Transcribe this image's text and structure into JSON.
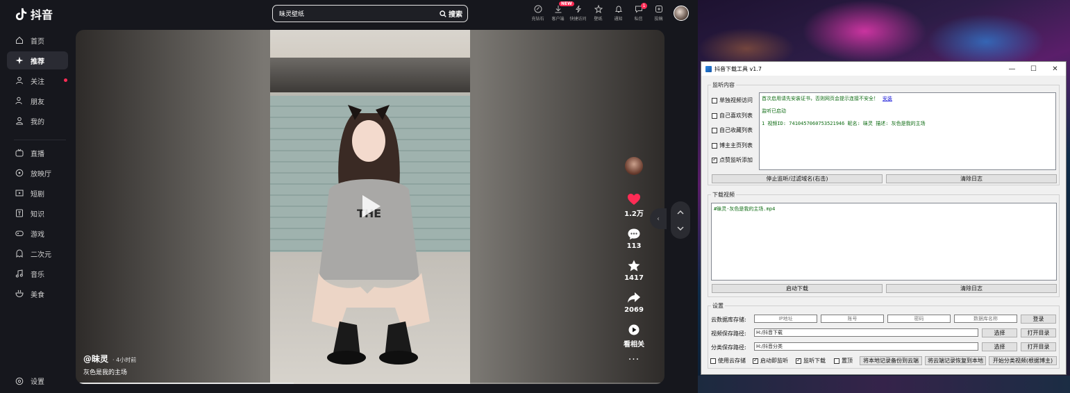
{
  "app": {
    "brand": "抖音"
  },
  "sidebar": {
    "items": [
      {
        "label": "首页"
      },
      {
        "label": "推荐"
      },
      {
        "label": "关注"
      },
      {
        "label": "朋友"
      },
      {
        "label": "我的"
      },
      {
        "label": "直播"
      },
      {
        "label": "放映厅"
      },
      {
        "label": "短剧"
      },
      {
        "label": "知识"
      },
      {
        "label": "游戏"
      },
      {
        "label": "二次元"
      },
      {
        "label": "音乐"
      },
      {
        "label": "美食"
      }
    ],
    "settings_label": "设置"
  },
  "search": {
    "value": "昧灵壁纸",
    "button_label": "搜索"
  },
  "top_actions": [
    {
      "label": "充钻石",
      "icon": "diamond-icon"
    },
    {
      "label": "客户端",
      "icon": "download-icon",
      "badge": "NEW"
    },
    {
      "label": "快捷访问",
      "icon": "bolt-icon"
    },
    {
      "label": "壁纸",
      "icon": "wallpaper-icon"
    },
    {
      "label": "通知",
      "icon": "bell-icon"
    },
    {
      "label": "私信",
      "icon": "message-icon",
      "badge": "1"
    },
    {
      "label": "投稿",
      "icon": "upload-icon"
    }
  ],
  "video": {
    "author": "@昧灵",
    "time": "· 4小时前",
    "description": "灰色是我的主场",
    "progress": 0.37,
    "likes": "1.2万",
    "comments": "113",
    "favorites": "1417",
    "shares": "2069",
    "related_label": "看相关",
    "more": "···"
  },
  "tool": {
    "title": "抖音下载工具 v1.7",
    "listen_group": "监听内容",
    "options": [
      {
        "label": "单独视频访问",
        "checked": false
      },
      {
        "label": "自己喜欢列表",
        "checked": false
      },
      {
        "label": "自己收藏列表",
        "checked": false
      },
      {
        "label": "博主主页列表",
        "checked": false
      },
      {
        "label": "点赞监听添加",
        "checked": true
      }
    ],
    "listen_log": {
      "line1": "首次启用请先安装证书，否则网页会提示连接不安全！",
      "line1_link": "安装",
      "line2": "监听已启动",
      "line3": "1 视频ID: 7410457060753521946 昵名: 昧灵 描述: 灰色是我的主场"
    },
    "stop_btn": "停止监听/过滤域名(右击)",
    "clear_log_btn": "清除日志",
    "download_group": "下载视频",
    "download_log": "#昧灵-灰色是我的主场.mp4",
    "start_download_btn": "启动下载",
    "clear_log_btn2": "清除日志",
    "settings_group": "设置",
    "cloud_label": "云数据库存储:",
    "cloud_fields": [
      "IP地址",
      "账号",
      "密码",
      "数据库名称"
    ],
    "login_btn": "登录",
    "video_path_label": "视频保存路径:",
    "video_path": "H:/抖音下载",
    "class_path_label": "分类保存路径:",
    "class_path": "H:/抖音分类",
    "choose_btn": "选择",
    "open_dir_btn": "打开目录",
    "footer_options": [
      {
        "label": "使用云存储",
        "checked": false
      },
      {
        "label": "启动即监听",
        "checked": true
      },
      {
        "label": "监听下载",
        "checked": true
      },
      {
        "label": "置顶",
        "checked": false
      }
    ],
    "backup_btn": "将本地记录备份到云端",
    "restore_btn": "将云端记录恢复到本地",
    "classify_btn": "开始分类视频(根据博主)"
  }
}
